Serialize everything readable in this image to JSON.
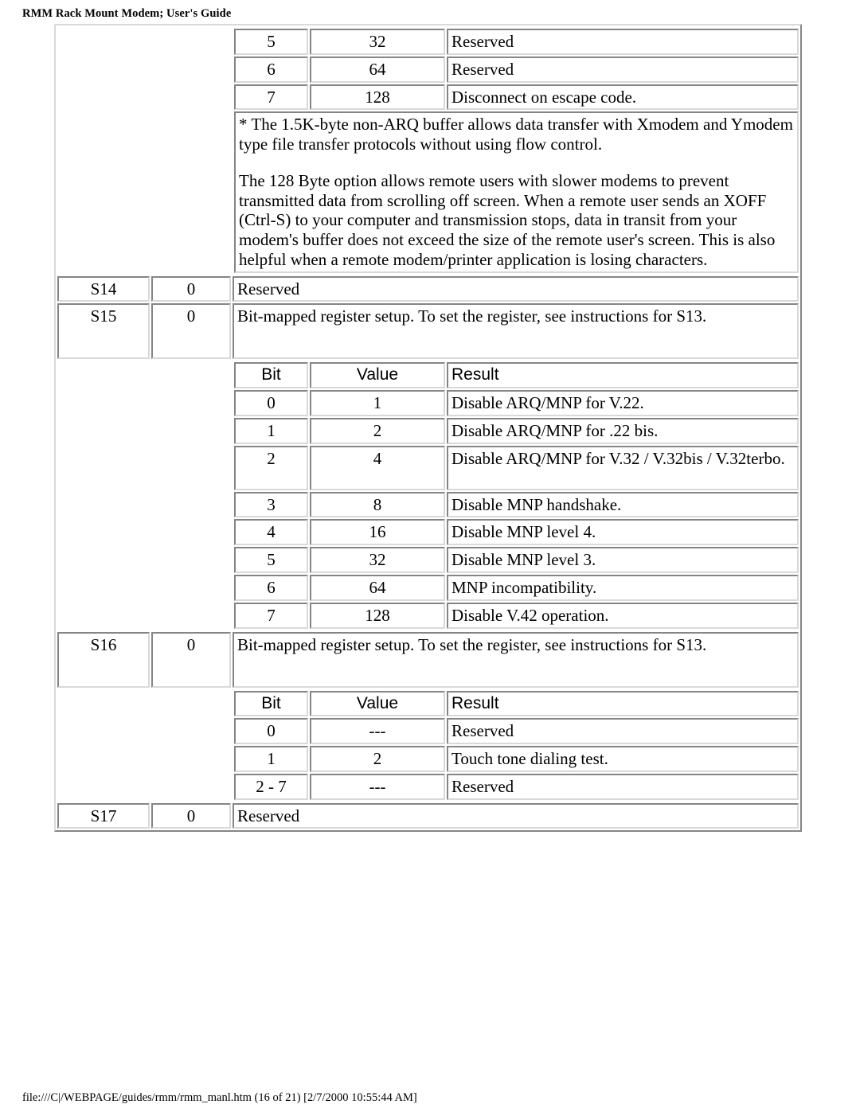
{
  "header": {
    "title": "RMM Rack Mount Modem; User's Guide"
  },
  "footer": {
    "text": "file:///C|/WEBPAGE/guides/rmm/rmm_manl.htm (16 of 21) [2/7/2000 10:55:44 AM]"
  },
  "s13_tail_rows": [
    {
      "bit": "5",
      "value": "32",
      "result": "Reserved"
    },
    {
      "bit": "6",
      "value": "64",
      "result": "Reserved"
    },
    {
      "bit": "7",
      "value": "128",
      "result": "Disconnect on escape code."
    }
  ],
  "note": {
    "paragraph1": "* The 1.5K-byte non-ARQ buffer allows data transfer with Xmodem and Ymodem type file transfer protocols without using flow control.",
    "paragraph2": "The 128 Byte option allows remote users with slower modems to prevent transmitted data from scrolling off screen. When a remote user sends an XOFF (Ctrl-S) to your computer and transmission stops, data in transit from your modem's buffer does not exceed the size of the remote user's screen. This is also helpful when a remote modem/printer application is losing characters."
  },
  "registers": {
    "s14": {
      "name": "S14",
      "default": "0",
      "description": "Reserved"
    },
    "s15": {
      "name": "S15",
      "default": "0",
      "description": "Bit-mapped register setup. To set the register, see instructions for S13."
    },
    "s16": {
      "name": "S16",
      "default": "0",
      "description": "Bit-mapped register setup. To set the register, see instructions for S13."
    },
    "s17": {
      "name": "S17",
      "default": "0",
      "description": "Reserved"
    }
  },
  "bit_table_headers": {
    "bit": "Bit",
    "value": "Value",
    "result": "Result"
  },
  "s15_bits": [
    {
      "bit": "0",
      "value": "1",
      "result": "Disable ARQ/MNP for V.22."
    },
    {
      "bit": "1",
      "value": "2",
      "result": "Disable ARQ/MNP for .22 bis."
    },
    {
      "bit": "2",
      "value": "4",
      "result": "Disable ARQ/MNP for V.32 / V.32bis / V.32terbo."
    },
    {
      "bit": "3",
      "value": "8",
      "result": "Disable MNP handshake."
    },
    {
      "bit": "4",
      "value": "16",
      "result": "Disable MNP level 4."
    },
    {
      "bit": "5",
      "value": "32",
      "result": "Disable MNP level 3."
    },
    {
      "bit": "6",
      "value": "64",
      "result": "MNP incompatibility."
    },
    {
      "bit": "7",
      "value": "128",
      "result": "Disable V.42 operation."
    }
  ],
  "s16_bits": [
    {
      "bit": "0",
      "value": "---",
      "result": "Reserved"
    },
    {
      "bit": "1",
      "value": "2",
      "result": "Touch tone dialing test."
    },
    {
      "bit": "2 - 7",
      "value": "---",
      "result": "Reserved"
    }
  ]
}
